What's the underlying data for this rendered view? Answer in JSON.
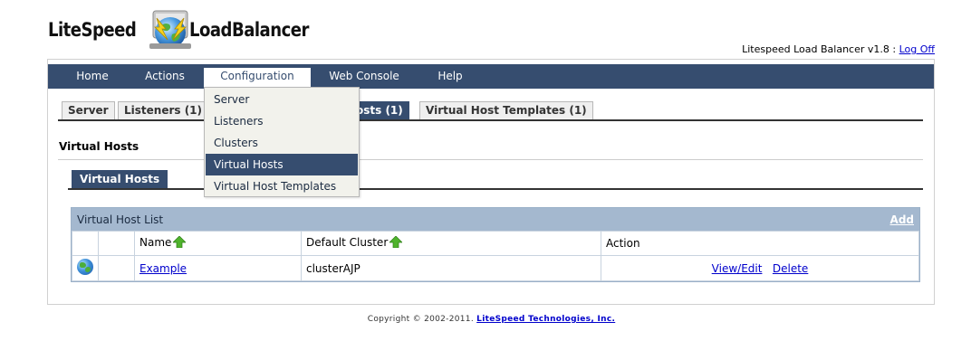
{
  "header": {
    "logo_left": "LiteSpeed",
    "logo_right": "LoadBalancer",
    "product_version": "Litespeed Load Balancer v1.8 :",
    "logoff_label": "Log Off"
  },
  "nav": {
    "items": [
      {
        "label": "Home"
      },
      {
        "label": "Actions"
      },
      {
        "label": "Configuration"
      },
      {
        "label": "Web Console"
      },
      {
        "label": "Help"
      }
    ],
    "active": "Configuration"
  },
  "tabs": [
    {
      "label": "Server"
    },
    {
      "label": "Listeners (1)"
    },
    {
      "label": "Virtual Hosts (1)"
    },
    {
      "label": "Virtual Host Templates (1)"
    }
  ],
  "visible_tab_fragment": "osts (1)",
  "section_title": "Virtual Hosts",
  "subtab_label": "Virtual Hosts",
  "table": {
    "caption": "Virtual Host List",
    "add_label": "Add",
    "columns": [
      "",
      "",
      "Name",
      "Default Cluster",
      "Action"
    ],
    "rows": [
      {
        "name": "Example",
        "cluster": "clusterAJP",
        "action_view": "View/Edit",
        "action_delete": "Delete"
      }
    ]
  },
  "dropdown": {
    "items": [
      {
        "label": "Server"
      },
      {
        "label": "Listeners"
      },
      {
        "label": "Clusters"
      },
      {
        "label": "Virtual Hosts"
      },
      {
        "label": "Virtual Host Templates"
      }
    ],
    "selected": "Virtual Hosts"
  },
  "footer": {
    "copyright": "Copyright © 2002-2011.",
    "company_link": "LiteSpeed Technologies, Inc."
  },
  "colors": {
    "nav_bg": "#364d6f",
    "table_header_bg": "#a4b8cf",
    "link": "#0000cc"
  }
}
